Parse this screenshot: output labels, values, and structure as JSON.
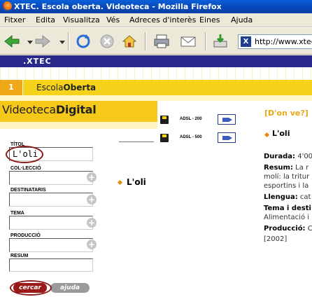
{
  "window": {
    "title": "XTEC. Escola oberta. Videoteca - Mozilla Firefox"
  },
  "menu": [
    "Fitxer",
    "Edita",
    "Visualitza",
    "Vés",
    "Adreces d'interès",
    "Eines",
    "Ajuda"
  ],
  "toolbar": {
    "icons": [
      "back-icon",
      "dropdown-icon",
      "forward-icon",
      "dropdown-icon",
      "reload-icon",
      "stop-icon",
      "home-icon",
      "print-icon",
      "mail-icon",
      "download-icon"
    ],
    "url": "http://www.xtec"
  },
  "site": {
    "brand_bar": ".XTEC",
    "section_number": "1",
    "section_name_light": "Escola",
    "section_name_bold": "Oberta"
  },
  "videoteca": {
    "title_light": "Videoteca",
    "title_bold": "Digital"
  },
  "form": {
    "title_label": "TÍTOL",
    "title_value": "L'oli",
    "collection_label": "COL·LECCIÓ",
    "recipients_label": "DESTINATARIS",
    "topic_label": "TEMA",
    "production_label": "PRODUCCIÓ",
    "summary_label": "RESUM",
    "search_button": "cercar",
    "help_button": "ajuda"
  },
  "results": {
    "item_title": "L'oli",
    "downloads": [
      {
        "label": "ADSL - 200"
      },
      {
        "label": "ADSL - 500"
      }
    ]
  },
  "detail": {
    "header": "[D'on ve?]",
    "title": "L'oli",
    "durada_label": "Durada:",
    "durada_value": "4'00",
    "resum_label": "Resum:",
    "resum_value": "La r",
    "resum_line2": "molí: la tritur",
    "resum_line3": "esportins i la",
    "llengua_label": "Llengua:",
    "llengua_value": "cat",
    "tema_label": "Tema i desti",
    "tema_line2": "Alimentació i",
    "produccio_label": "Producció:",
    "produccio_value": "C",
    "year": "[2002]"
  },
  "colors": {
    "title_bar": "#0846b8",
    "xtec_bar": "#2a2a8c",
    "yellow": "#f5d31a",
    "accent_orange": "#e9a614",
    "highlight_ring": "#8b1a1a",
    "search_button": "#9a1818",
    "help_button": "#9a9a9a"
  }
}
